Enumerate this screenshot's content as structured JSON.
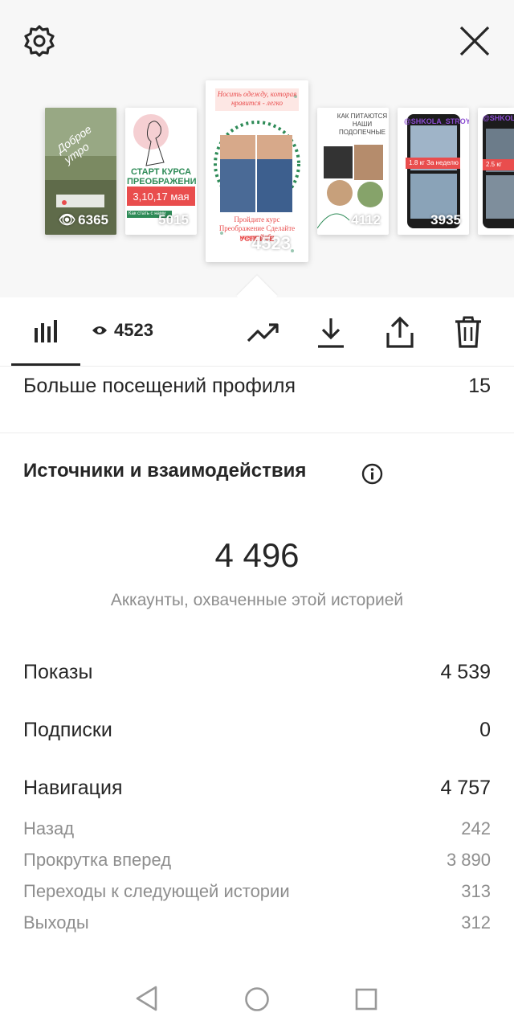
{
  "thumbs": [
    {
      "count": "6365",
      "text1": "Доброе утро",
      "has_eye": true
    },
    {
      "count": "5015",
      "title": "СТАРТ КУРСА ПРЕОБРАЖЕНИЕ",
      "date": "3,10,17 мая",
      "button": "Как стать с нами"
    },
    {
      "count": "4523",
      "top": "Носить одежду, которая нравится - легко",
      "bottom": "Пройдите курс Преображение Сделайте новую себя",
      "cta": "УСПЕЙТЕ"
    },
    {
      "count": "4112",
      "title": "КАК ПИТАЮТСЯ НАШИ ПОДОПЕЧНЫЕ"
    },
    {
      "count": "3935",
      "handle": "@SHKOLA_STROYNOSTI",
      "label": "1.8 кг За неделю"
    },
    {
      "count": "",
      "handle": "@SHKOLA_S",
      "label": "2.5 кг"
    }
  ],
  "toolbar": {
    "views": "4523",
    "icons": [
      "bar-chart-icon",
      "eye-icon",
      "trend-icon",
      "download-icon",
      "share-icon",
      "trash-icon"
    ]
  },
  "profile_visits": {
    "label": "Больше посещений профиля",
    "value": "15"
  },
  "section_title": "Источники и взаимодействия",
  "reach": {
    "value": "4 496",
    "label": "Аккаунты, охваченные этой историей"
  },
  "metrics": [
    {
      "label": "Показы",
      "value": "4 539"
    },
    {
      "label": "Подписки",
      "value": "0"
    },
    {
      "label": "Навигация",
      "value": "4 757"
    }
  ],
  "nav_details": [
    {
      "label": "Назад",
      "value": "242"
    },
    {
      "label": "Прокрутка вперед",
      "value": "3 890"
    },
    {
      "label": "Переходы к следующей истории",
      "value": "313"
    },
    {
      "label": "Выходы",
      "value": "312"
    }
  ],
  "colors": {
    "accent": "#262626",
    "muted": "#8e8e8e",
    "story_red": "#e94d4d",
    "story_green": "#2e8b57"
  }
}
